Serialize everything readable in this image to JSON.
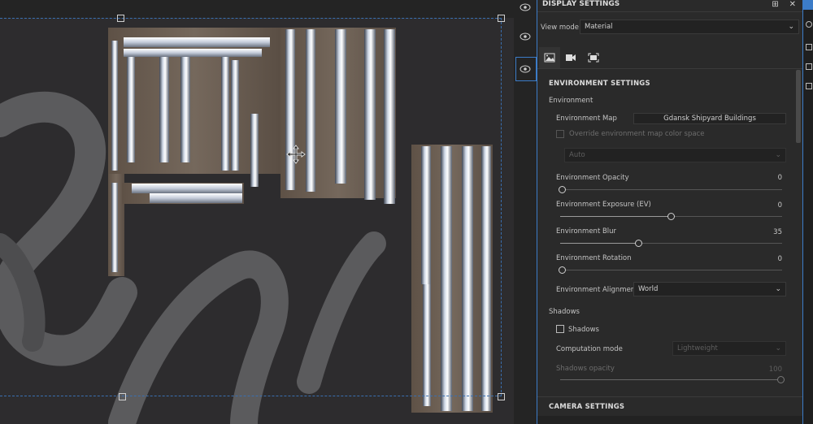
{
  "panel": {
    "title": "DISPLAY SETTINGS",
    "view_mode_label": "View mode",
    "view_mode_value": "Material",
    "tabs": [
      "environment-tab",
      "camera-tab",
      "frame-tab"
    ]
  },
  "environment": {
    "section_title": "ENVIRONMENT SETTINGS",
    "group_label": "Environment",
    "map_label": "Environment Map",
    "map_value": "Gdansk Shipyard Buildings",
    "override_label": "Override environment map color space",
    "colorspace_value": "Auto",
    "opacity_label": "Environment Opacity",
    "opacity_value": "0",
    "opacity_level": 0,
    "exposure_label": "Environment Exposure (EV)",
    "exposure_value": "0",
    "exposure_level": 0.5,
    "blur_label": "Environment Blur",
    "blur_value": "35",
    "blur_level": 0.35,
    "rotation_label": "Environment Rotation",
    "rotation_value": "0",
    "rotation_level": 0,
    "alignment_label": "Environment Alignment",
    "alignment_value": "World"
  },
  "shadows": {
    "group_label": "Shadows",
    "checkbox_label": "Shadows",
    "computation_label": "Computation mode",
    "computation_value": "Lightweight",
    "opacity_label": "Shadows opacity",
    "opacity_value": "100",
    "opacity_level": 1
  },
  "camera": {
    "section_title": "CAMERA SETTINGS"
  },
  "colors": {
    "accent": "#3c7cc8",
    "panel_bg": "#2a2a2a",
    "canvas_bg": "#2d2c2e"
  }
}
